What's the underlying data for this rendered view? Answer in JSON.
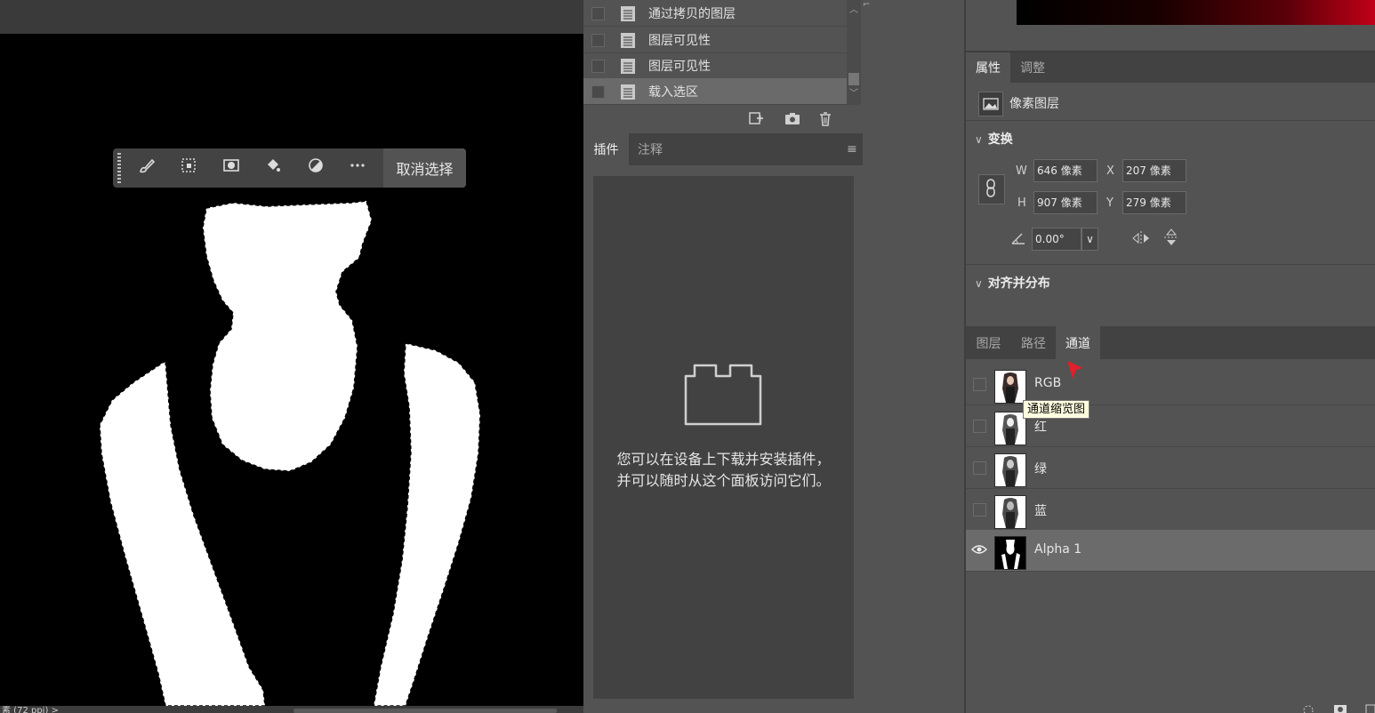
{
  "canvas": {
    "status_text": "素 (72 ppi) >",
    "taskbar": {
      "icons": [
        "brush-icon",
        "transform-selection-icon",
        "mask-icon",
        "fill-bucket-icon",
        "invert-icon",
        "more-icon"
      ],
      "deselect_label": "取消选择"
    }
  },
  "history": {
    "items": [
      {
        "label": "通过拷贝的图层",
        "selected": false
      },
      {
        "label": "图层可见性",
        "selected": false
      },
      {
        "label": "图层可见性",
        "selected": false
      },
      {
        "label": "载入选区",
        "selected": true
      }
    ],
    "footer_icons": [
      "new-document-from-state-icon",
      "snapshot-camera-icon",
      "trash-icon"
    ]
  },
  "plugins": {
    "tabs": [
      {
        "label": "插件",
        "active": true
      },
      {
        "label": "注释",
        "active": false
      }
    ],
    "empty_message": "您可以在设备上下载并安装插件，并可以随时从这个面板访问它们。",
    "menu_icon": "panel-menu-icon",
    "empty_icon": "plugin-block-icon"
  },
  "properties": {
    "tabs": [
      {
        "label": "属性",
        "active": true
      },
      {
        "label": "调整",
        "active": false
      }
    ],
    "layer_type": "像素图层",
    "transform": {
      "title": "变换",
      "w_label": "W",
      "w_value": "646 像素",
      "h_label": "H",
      "h_value": "907 像素",
      "x_label": "X",
      "x_value": "207 像素",
      "y_label": "Y",
      "y_value": "279 像素",
      "angle_value": "0.00°"
    },
    "align": {
      "title": "对齐并分布"
    }
  },
  "channels": {
    "tabs": [
      {
        "label": "图层",
        "active": false
      },
      {
        "label": "路径",
        "active": false
      },
      {
        "label": "通道",
        "active": true
      }
    ],
    "rows": [
      {
        "name": "RGB",
        "visible": false,
        "selected": false
      },
      {
        "name": "红",
        "visible": false,
        "selected": false
      },
      {
        "name": "绿",
        "visible": false,
        "selected": false
      },
      {
        "name": "蓝",
        "visible": false,
        "selected": false
      },
      {
        "name": "Alpha 1",
        "visible": true,
        "selected": true
      }
    ],
    "tooltip": "通道缩览图"
  },
  "colors": {
    "panel_bg": "#535353",
    "tab_bar_bg": "#424242",
    "selected_row": "#6b6b6b",
    "tooltip_bg": "#ffffe1",
    "cursor_red": "#e0202a"
  }
}
